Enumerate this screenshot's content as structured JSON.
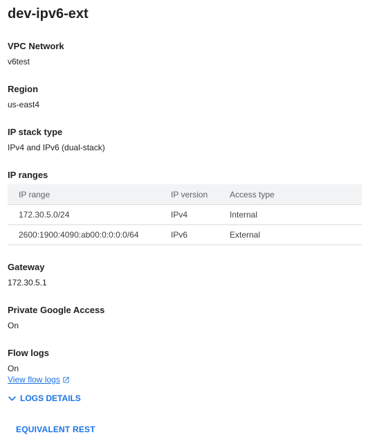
{
  "title": "dev-ipv6-ext",
  "fields": {
    "vpc_network": {
      "label": "VPC Network",
      "value": "v6test"
    },
    "region": {
      "label": "Region",
      "value": "us-east4"
    },
    "ip_stack_type": {
      "label": "IP stack type",
      "value": "IPv4 and IPv6 (dual-stack)"
    },
    "ip_ranges": {
      "label": "IP ranges"
    },
    "gateway": {
      "label": "Gateway",
      "value": "172.30.5.1"
    },
    "private_google_access": {
      "label": "Private Google Access",
      "value": "On"
    },
    "flow_logs": {
      "label": "Flow logs",
      "value": "On"
    }
  },
  "ip_table": {
    "headers": [
      "IP range",
      "IP version",
      "Access type"
    ],
    "rows": [
      [
        "172.30.5.0/24",
        "IPv4",
        "Internal"
      ],
      [
        "2600:1900:4090:ab00:0:0:0:0/64",
        "IPv6",
        "External"
      ]
    ]
  },
  "view_flow_logs_link": "View flow logs",
  "logs_details_label": "LOGS DETAILS",
  "equivalent_rest_label": "EQUIVALENT REST",
  "colors": {
    "accent": "#1a73e8",
    "text": "#202124",
    "table_header_bg": "#f1f3f4",
    "divider": "#dadce0"
  },
  "icons": {
    "external_link": "open-in-new-icon",
    "chevron": "chevron-down-icon"
  }
}
